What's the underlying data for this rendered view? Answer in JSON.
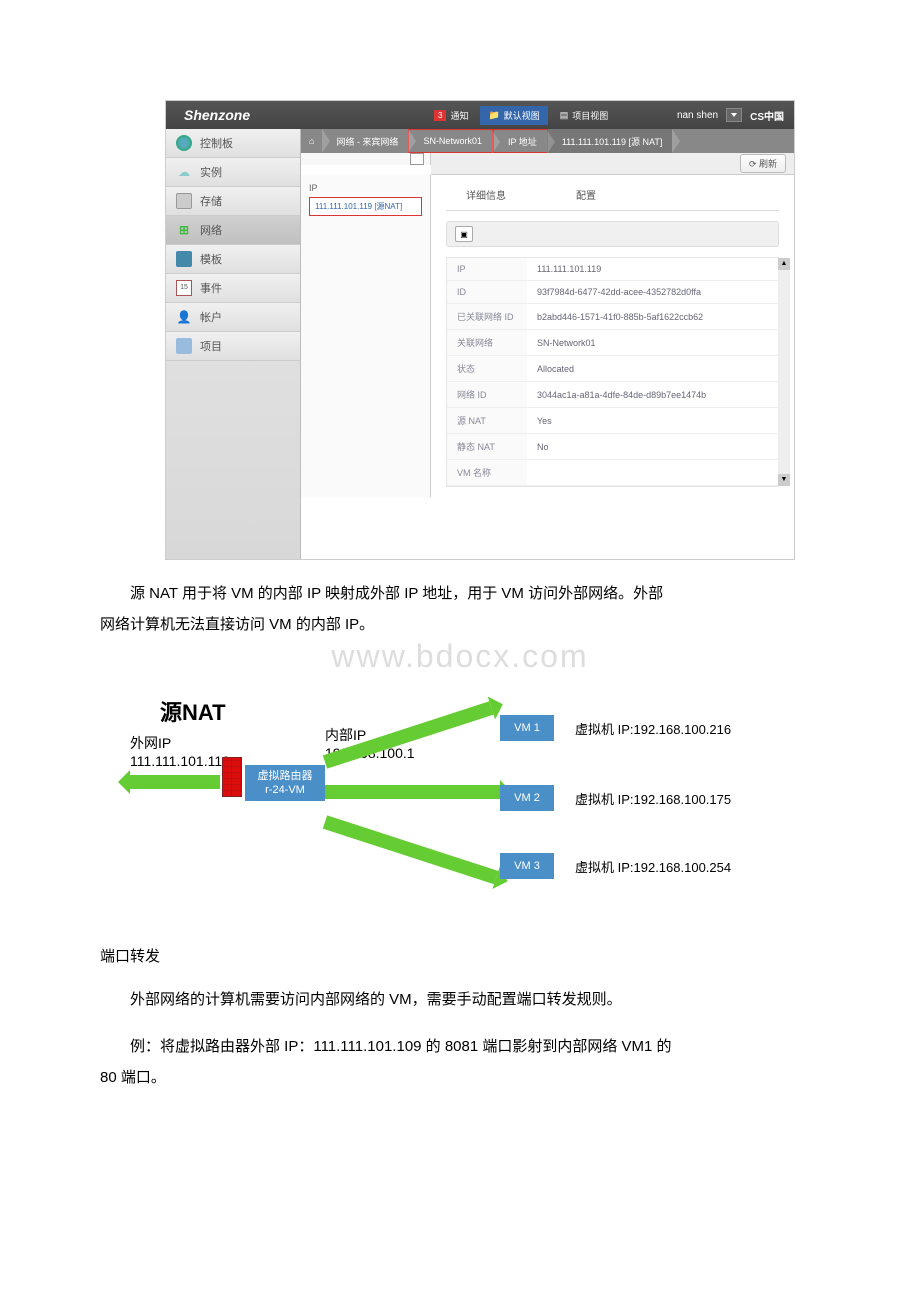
{
  "header": {
    "logo": "Shenzone",
    "notif_count": "3",
    "notif_label": "通知",
    "default_view": "默认视图",
    "project_view": "项目视图",
    "username": "nan shen",
    "region": "CS中国"
  },
  "sidebar": {
    "items": [
      {
        "label": "控制板"
      },
      {
        "label": "实例"
      },
      {
        "label": "存储"
      },
      {
        "label": "网络"
      },
      {
        "label": "模板"
      },
      {
        "label": "事件"
      },
      {
        "label": "帐户"
      },
      {
        "label": "项目"
      }
    ]
  },
  "breadcrumb": {
    "home": "⌂",
    "items": [
      {
        "label": "网络 - 来宾网络"
      },
      {
        "label": "SN-Network01"
      },
      {
        "label": "IP 地址"
      },
      {
        "label": "111.111.101.119 [源 NAT]"
      }
    ]
  },
  "toolbar": {
    "refresh": "刷新"
  },
  "ip_panel": {
    "header": "IP",
    "entry": "111.111.101.119 [源NAT]"
  },
  "tabs": {
    "detail": "详细信息",
    "config": "配置"
  },
  "details": {
    "rows": [
      {
        "k": "IP",
        "v": "111.111.101.119"
      },
      {
        "k": "ID",
        "v": "93f7984d-6477-42dd-acee-4352782d0ffa"
      },
      {
        "k": "已关联网络 ID",
        "v": "b2abd446-1571-41f0-885b-5af1622ccb62"
      },
      {
        "k": "关联网络",
        "v": "SN-Network01"
      },
      {
        "k": "状态",
        "v": "Allocated"
      },
      {
        "k": "网络 ID",
        "v": "3044ac1a-a81a-4dfe-84de-d89b7ee1474b"
      },
      {
        "k": "源 NAT",
        "v": "Yes"
      },
      {
        "k": "静态 NAT",
        "v": "No"
      },
      {
        "k": "VM 名称",
        "v": ""
      }
    ]
  },
  "paragraphs": {
    "p1": "源 NAT 用于将 VM 的内部 IP 映射成外部 IP 地址，用于 VM 访问外部网络。外部网络计算机无法直接访问 VM 的内部 IP。",
    "p1_line1": "源 NAT 用于将 VM 的内部 IP 映射成外部 IP 地址，用于 VM 访问外部网络。外部",
    "p1_line2": "网络计算机无法直接访问 VM 的内部 IP。",
    "watermark": "www.bdocx.com",
    "section": "端口转发",
    "p2": "外部网络的计算机需要访问内部网络的 VM，需要手动配置端口转发规则。",
    "p3_line1": "例：将虚拟路由器外部 IP：111.111.101.109 的 8081 端口影射到内部网络 VM1 的",
    "p3_line2": "80 端口。"
  },
  "diagram": {
    "title": "源NAT",
    "out_ip_label": "外网IP",
    "out_ip": "111.111.101.119",
    "in_ip_label": "内部IP",
    "in_ip": "192.168.100.1",
    "router_l1": "虚拟路由器",
    "router_l2": "r-24-VM",
    "vm1": "VM 1",
    "vm2": "VM 2",
    "vm3": "VM 3",
    "vm1_ip": "虚拟机 IP:192.168.100.216",
    "vm2_ip": "虚拟机 IP:192.168.100.175",
    "vm3_ip": "虚拟机 IP:192.168.100.254"
  },
  "event_day": "15"
}
